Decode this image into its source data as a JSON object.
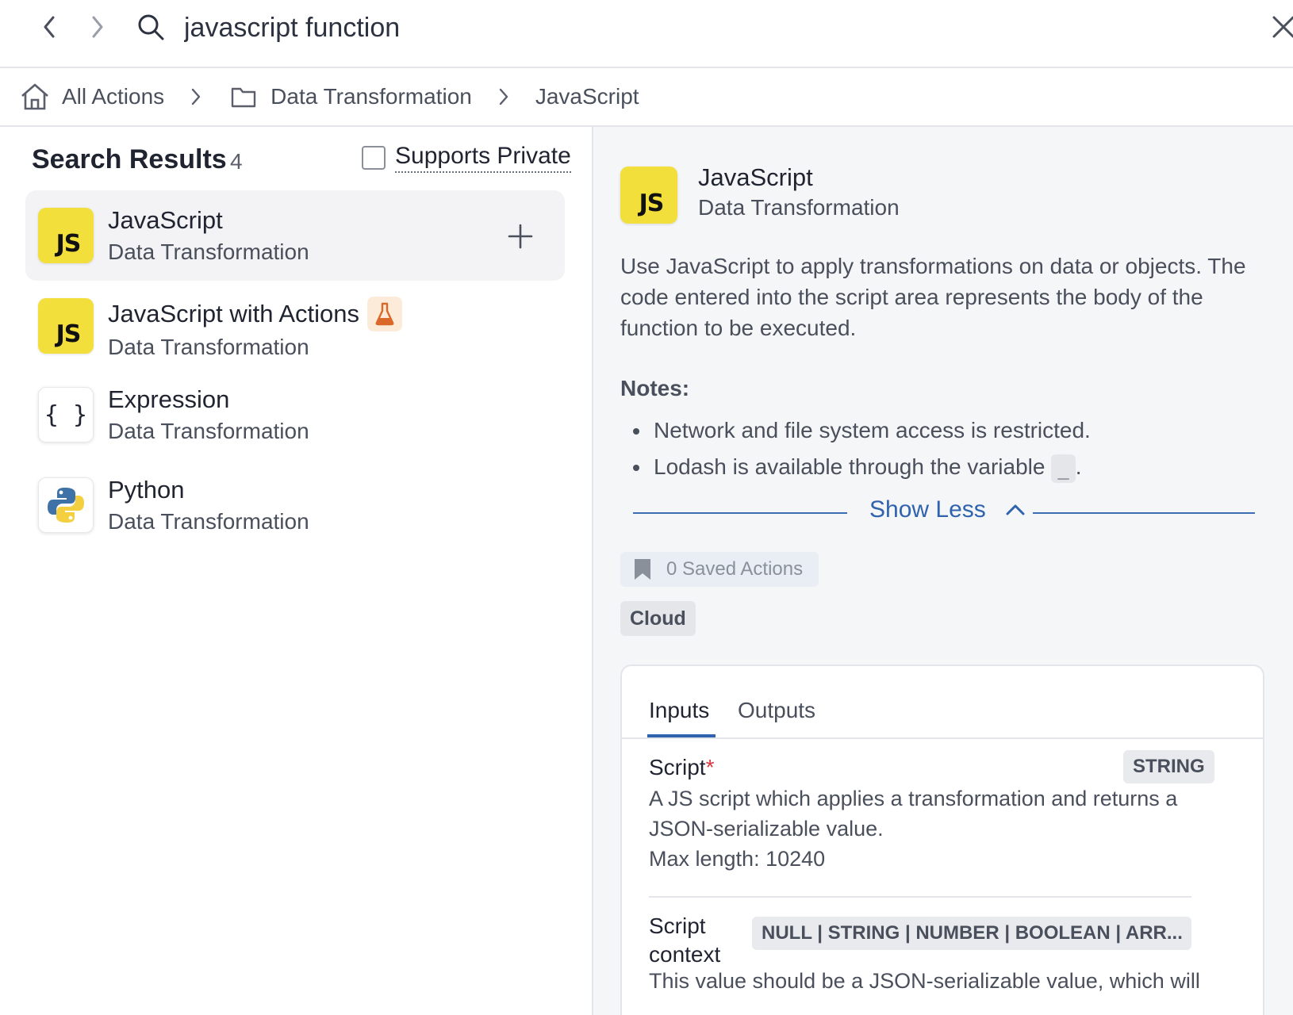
{
  "search": {
    "query": "javascript function"
  },
  "breadcrumb": [
    {
      "label": "All Actions"
    },
    {
      "label": "Data Transformation"
    },
    {
      "label": "JavaScript"
    }
  ],
  "results": {
    "title": "Search Results",
    "count": "4",
    "filter_label": "Supports Private",
    "items": [
      {
        "name": "JavaScript",
        "category": "Data Transformation",
        "icon": "js-logo",
        "selected": true
      },
      {
        "name": "JavaScript with Actions",
        "category": "Data Transformation",
        "icon": "js-logo",
        "badge": "beta-flask-icon"
      },
      {
        "name": "Expression",
        "category": "Data Transformation",
        "icon": "braces"
      },
      {
        "name": "Python",
        "category": "Data Transformation",
        "icon": "python-logo"
      }
    ]
  },
  "icon_text": {
    "js": "JS",
    "braces": "{ }"
  },
  "detail": {
    "name": "JavaScript",
    "category": "Data Transformation",
    "description": "Use JavaScript to apply transformations on data or objects. The code entered into the script area represents the body of the function to be executed.",
    "notes_title": "Notes:",
    "notes": [
      "Network and file system access is restricted.",
      "Lodash is available through the variable"
    ],
    "notes_code": "_",
    "notes_suffix": ".",
    "show_less": "Show Less",
    "saved_actions": "0 Saved Actions",
    "cloud_tag": "Cloud",
    "tabs": [
      {
        "label": "Inputs",
        "active": true
      },
      {
        "label": "Outputs"
      }
    ],
    "inputs": [
      {
        "name": "Script",
        "required_mark": "*",
        "type": "STRING",
        "description": "A JS script which applies a transformation and returns a JSON-serializable value.",
        "max_length": "Max length: 10240"
      },
      {
        "name_line1": "Script",
        "name_line2": "context",
        "type": "NULL | STRING | NUMBER | BOOLEAN | ARR...",
        "description": "This value should be a JSON-serializable value, which will"
      }
    ]
  },
  "colors": {
    "accent": "#2f63ad",
    "js_yellow": "#f3df3c",
    "required": "#d9363e",
    "beta": "#d9682a"
  }
}
